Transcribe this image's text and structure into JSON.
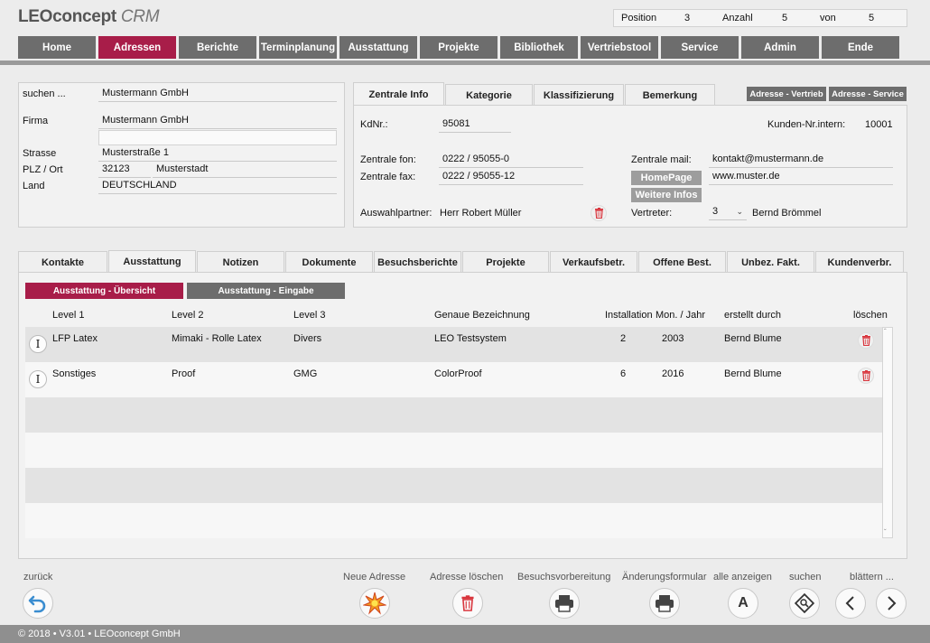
{
  "header": {
    "logo_main": "LEOconcept",
    "logo_sub": "CRM",
    "position_label": "Position",
    "position_value": "3",
    "anzahl_label": "Anzahl",
    "anzahl_value": "5",
    "von_label": "von",
    "von_value": "5"
  },
  "nav": [
    "Home",
    "Adressen",
    "Berichte",
    "Terminplanung",
    "Ausstattung",
    "Projekte",
    "Bibliothek",
    "Vertriebstool",
    "Service",
    "Admin",
    "Ende"
  ],
  "nav_active": "Adressen",
  "address": {
    "search_label": "suchen ...",
    "search_value": "Mustermann GmbH",
    "firma_label": "Firma",
    "firma_value": "Mustermann GmbH",
    "firma2_value": "",
    "strasse_label": "Strasse",
    "strasse_value": "Musterstraße 1",
    "plz_label": "PLZ / Ort",
    "plz_value": "32123",
    "ort_value": "Musterstadt",
    "land_label": "Land",
    "land_value": "DEUTSCHLAND"
  },
  "info_tabs": [
    "Zentrale Info",
    "Kategorie",
    "Klassifizierung",
    "Bemerkung"
  ],
  "info_buttons": [
    "Adresse - Vertrieb",
    "Adresse - Service"
  ],
  "info": {
    "kdnr_label": "KdNr.:",
    "kdnr_value": "95081",
    "kunden_nr_label": "Kunden-Nr.intern:",
    "kunden_nr_value": "10001",
    "fon_label": "Zentrale fon:",
    "fon_value": "0222 / 95055-0",
    "fax_label": "Zentrale fax:",
    "fax_value": "0222 / 95055-12",
    "mail_label": "Zentrale mail:",
    "mail_value": "kontakt@mustermann.de",
    "homepage_button": "HomePage",
    "homepage_value": "www.muster.de",
    "weitere_button": "Weitere Infos",
    "partner_label": "Auswahlpartner:",
    "partner_value": "Herr Robert Müller",
    "vertreter_label": "Vertreter:",
    "vertreter_select": "3",
    "vertreter_name": "Bernd Brömmel"
  },
  "main_tabs": [
    "Kontakte",
    "Ausstattung",
    "Notizen",
    "Dokumente",
    "Besuchsberichte",
    "Projekte",
    "Verkaufsbetr.",
    "Offene Best.",
    "Unbez. Fakt.",
    "Kundenverbr."
  ],
  "main_tab_active": "Ausstattung",
  "sub_buttons": [
    "Ausstattung - Übersicht",
    "Ausstattung - Eingabe"
  ],
  "table": {
    "columns": [
      "Level 1",
      "Level 2",
      "Level 3",
      "Genaue Bezeichnung",
      "Installation",
      "Mon. / Jahr",
      "erstellt durch",
      "löschen"
    ],
    "rows": [
      {
        "l1": "LFP Latex",
        "l2": "Mimaki - Rolle Latex",
        "l3": "Divers",
        "bez": "LEO Testsystem",
        "inst": "2",
        "jahr": "2003",
        "by": "Bernd Blume"
      },
      {
        "l1": "Sonstiges",
        "l2": "Proof",
        "l3": "GMG",
        "bez": "ColorProof",
        "inst": "6",
        "jahr": "2016",
        "by": "Bernd Blume"
      }
    ]
  },
  "toolbar": {
    "zurueck": "zurück",
    "neue_adresse": "Neue Adresse",
    "adresse_loeschen": "Adresse löschen",
    "besuchsvorbereitung": "Besuchsvorbereitung",
    "aenderungsformular": "Änderungsformular",
    "alle_anzeigen": "alle anzeigen",
    "suchen": "suchen",
    "blaettern": "blättern ...",
    "alle_icon_letter": "A"
  },
  "footer": "© 2018 • V3.01 • LEOconcept GmbH",
  "colors": {
    "accent": "#a81d49",
    "nav": "#6d6d6d",
    "trash": "#d9363e",
    "back": "#3a8dd0"
  }
}
